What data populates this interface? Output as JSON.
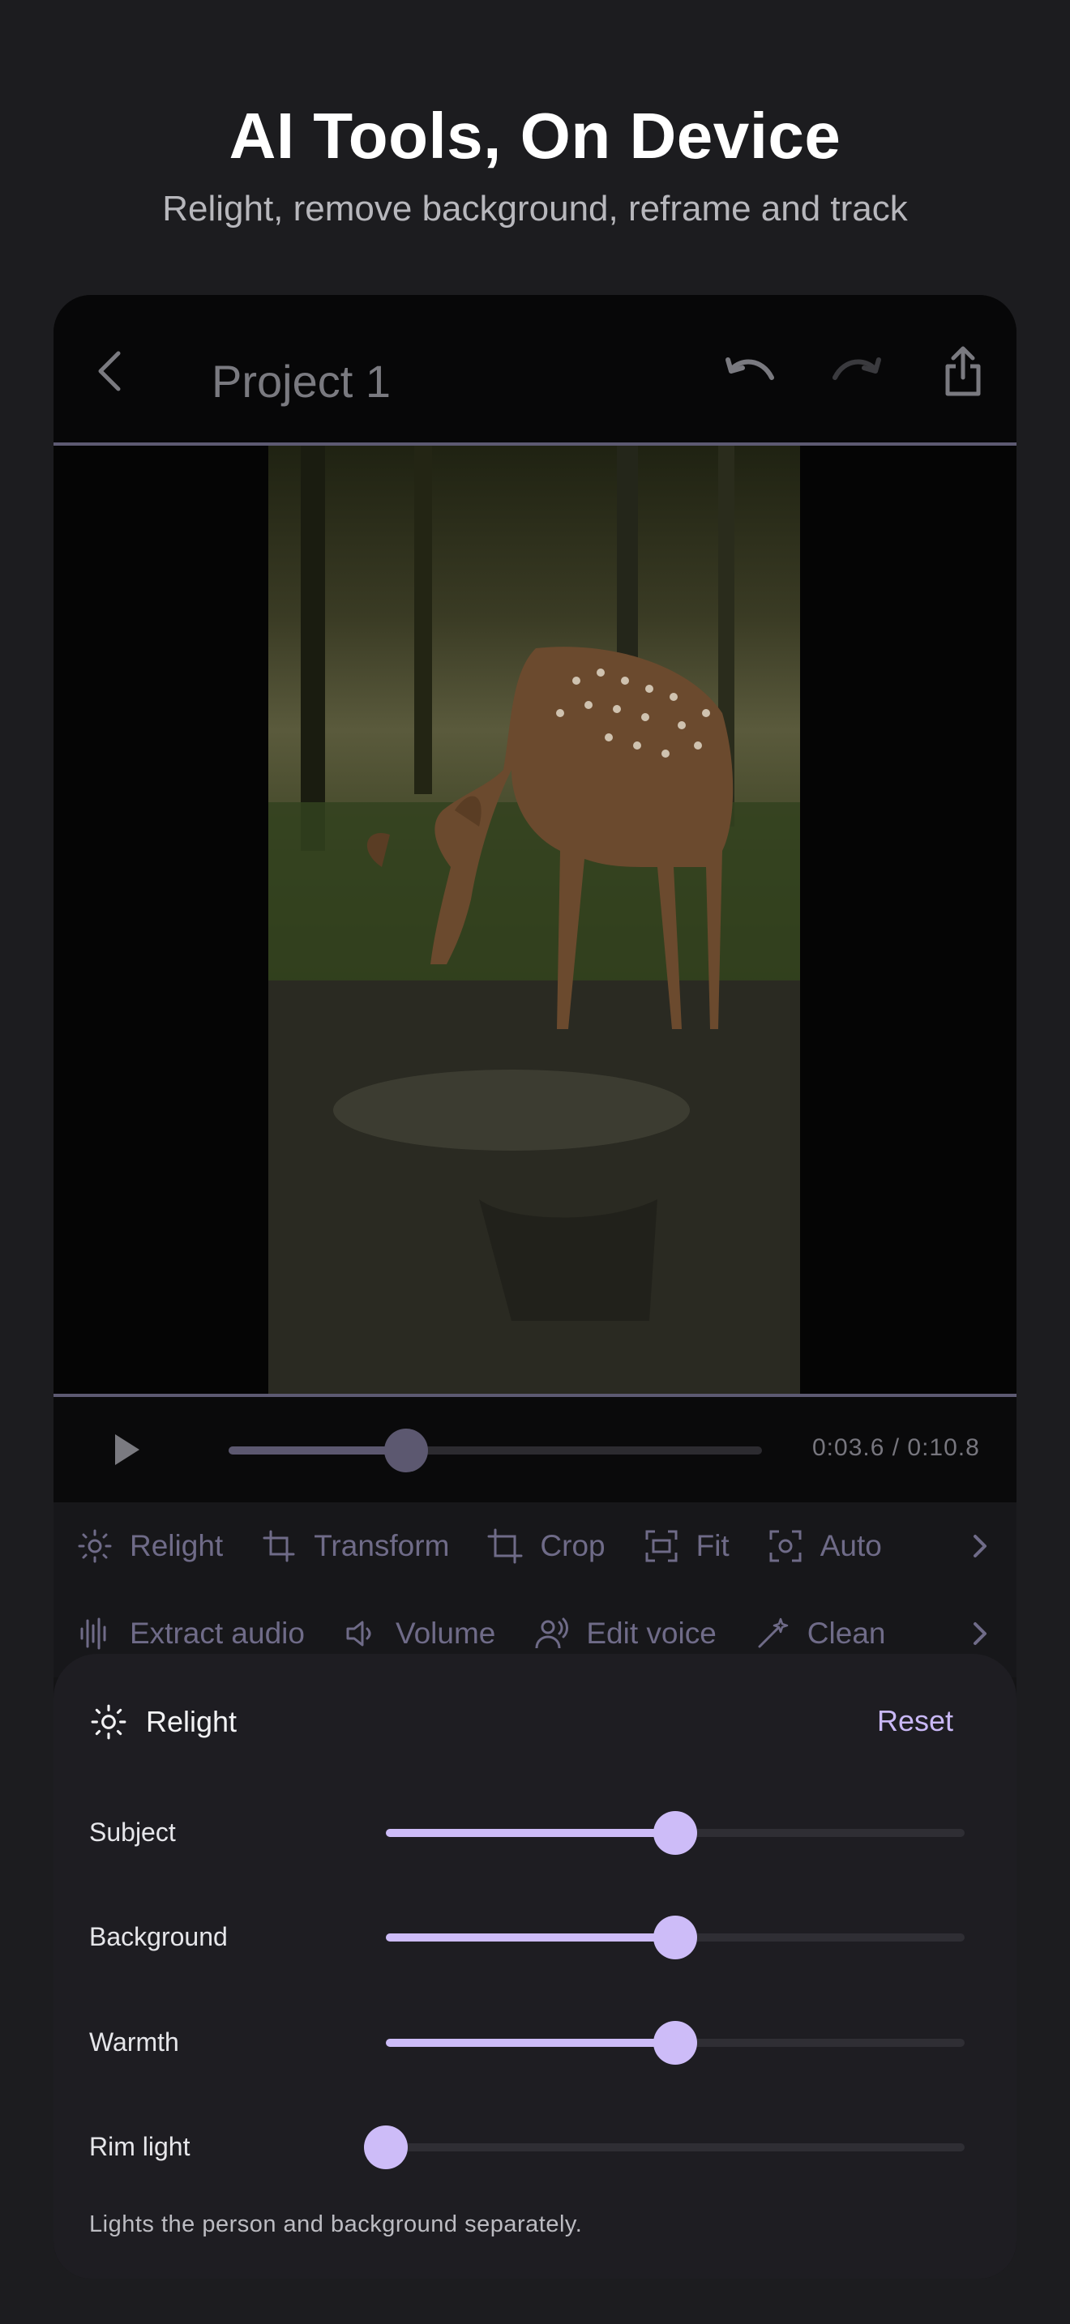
{
  "headline": "AI Tools, On Device",
  "subline": "Relight, remove background, reframe and track",
  "editor": {
    "project_title": "Project 1",
    "icons": {
      "back": "chevron-left-icon",
      "undo": "undo-icon",
      "redo": "redo-icon",
      "share": "share-icon"
    }
  },
  "playback": {
    "time": "0:03.6 / 0:10.8",
    "progress": 0.333
  },
  "tools_row1": [
    {
      "label": "Relight",
      "icon": "sun-icon"
    },
    {
      "label": "Transform",
      "icon": "transform-icon"
    },
    {
      "label": "Crop",
      "icon": "crop-icon"
    },
    {
      "label": "Fit",
      "icon": "fit-icon"
    },
    {
      "label": "Auto",
      "icon": "auto-frame-icon"
    }
  ],
  "tools_row2": [
    {
      "label": "Extract audio",
      "icon": "waveform-icon"
    },
    {
      "label": "Volume",
      "icon": "speaker-icon"
    },
    {
      "label": "Edit voice",
      "icon": "voice-icon"
    },
    {
      "label": "Clean",
      "icon": "magic-wand-icon"
    }
  ],
  "relight_panel": {
    "title": "Relight",
    "reset_label": "Reset",
    "sliders": [
      {
        "label": "Subject",
        "value": 0.5
      },
      {
        "label": "Background",
        "value": 0.5
      },
      {
        "label": "Warmth",
        "value": 0.5
      },
      {
        "label": "Rim light",
        "value": 0.0
      }
    ],
    "hint": "Lights the person and background separately."
  },
  "colors": {
    "accent": "#cdbcf8",
    "muted_tool": "#6f6b88",
    "background": "#1c1c1f"
  }
}
